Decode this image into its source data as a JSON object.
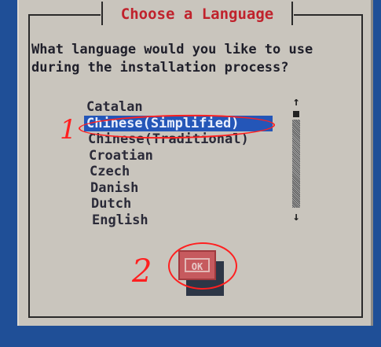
{
  "dialog": {
    "title": "Choose a Language",
    "prompt": "What language would you like to use\nduring the installation process?",
    "languages": [
      "Catalan",
      "Chinese(Simplified)",
      "Chinese(Traditional)",
      "Croatian",
      "Czech",
      "Danish",
      "Dutch",
      "English"
    ],
    "selected": "Chinese(Simplified)",
    "scroll_up": "↑",
    "scroll_down": "↓",
    "ok_label": "OK"
  },
  "annotations": {
    "step1": "1",
    "step2": "2",
    "color": "#ff2020"
  },
  "colors": {
    "background": "#1f4f97",
    "dialog": "#c9c5bd",
    "title": "#c0222c",
    "highlight": "#2456b8",
    "button": "#c65a5e"
  }
}
